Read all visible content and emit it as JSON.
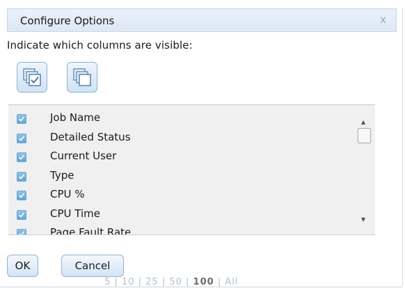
{
  "dialog": {
    "title": "Configure Options",
    "close_label": "x",
    "instruction": "Indicate which columns are visible:"
  },
  "toolbar": {
    "select_all_icon": "select-all-icon",
    "deselect_all_icon": "deselect-all-icon"
  },
  "columns": {
    "items": [
      {
        "label": "Job Name",
        "checked": true
      },
      {
        "label": "Detailed Status",
        "checked": true
      },
      {
        "label": "Current User",
        "checked": true
      },
      {
        "label": "Type",
        "checked": true
      },
      {
        "label": "CPU %",
        "checked": true
      },
      {
        "label": "CPU Time",
        "checked": true
      },
      {
        "label": "Page Fault Rate",
        "checked": true
      }
    ]
  },
  "buttons": {
    "ok_label": "OK",
    "cancel_label": "Cancel"
  },
  "pager": {
    "options": [
      "5",
      "10",
      "25",
      "50",
      "100",
      "All"
    ],
    "selected": "100"
  },
  "colors": {
    "title_bar": "#dde8f5",
    "button_border": "#8fb2d6",
    "checkbox": "#5aa8da",
    "list_background": "#f0f0f0"
  }
}
